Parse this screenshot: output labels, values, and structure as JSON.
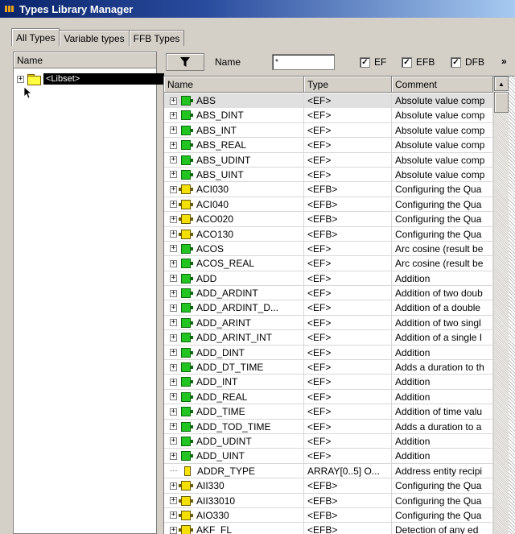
{
  "window": {
    "title": "Types Library Manager"
  },
  "tabs": [
    {
      "label": "All Types",
      "active": true
    },
    {
      "label": "Variable types",
      "active": false
    },
    {
      "label": "FFB Types",
      "active": false
    }
  ],
  "left_pane": {
    "header": "Name",
    "tree": [
      {
        "label": "<Libset>",
        "expander": "+",
        "icon": "folder-icon"
      }
    ]
  },
  "toolbar": {
    "filter_icon": "funnel-icon",
    "name_label": "Name",
    "name_value": "*",
    "checkboxes": [
      {
        "label": "EF",
        "checked": true
      },
      {
        "label": "EFB",
        "checked": true
      },
      {
        "label": "DFB",
        "checked": true
      }
    ],
    "more": "»"
  },
  "grid": {
    "columns": [
      "Name",
      "Type",
      "Comment"
    ],
    "rows": [
      {
        "name": "ABS",
        "type": "<EF>",
        "comment": "Absolute value comp",
        "icon": "ef"
      },
      {
        "name": "ABS_DINT",
        "type": "<EF>",
        "comment": "Absolute value comp",
        "icon": "ef"
      },
      {
        "name": "ABS_INT",
        "type": "<EF>",
        "comment": "Absolute value comp",
        "icon": "ef"
      },
      {
        "name": "ABS_REAL",
        "type": "<EF>",
        "comment": "Absolute value comp",
        "icon": "ef"
      },
      {
        "name": "ABS_UDINT",
        "type": "<EF>",
        "comment": "Absolute value comp",
        "icon": "ef"
      },
      {
        "name": "ABS_UINT",
        "type": "<EF>",
        "comment": "Absolute value comp",
        "icon": "ef"
      },
      {
        "name": "ACI030",
        "type": "<EFB>",
        "comment": "Configuring the Qua",
        "icon": "efb"
      },
      {
        "name": "ACI040",
        "type": "<EFB>",
        "comment": "Configuring the Qua",
        "icon": "efb"
      },
      {
        "name": "ACO020",
        "type": "<EFB>",
        "comment": "Configuring the Qua",
        "icon": "efb"
      },
      {
        "name": "ACO130",
        "type": "<EFB>",
        "comment": "Configuring the Qua",
        "icon": "efb"
      },
      {
        "name": "ACOS",
        "type": "<EF>",
        "comment": "Arc cosine (result be",
        "icon": "ef"
      },
      {
        "name": "ACOS_REAL",
        "type": "<EF>",
        "comment": "Arc cosine (result be",
        "icon": "ef"
      },
      {
        "name": "ADD",
        "type": "<EF>",
        "comment": "Addition",
        "icon": "ef"
      },
      {
        "name": "ADD_ARDINT",
        "type": "<EF>",
        "comment": "Addition of two doub",
        "icon": "ef"
      },
      {
        "name": "ADD_ARDINT_D...",
        "type": "<EF>",
        "comment": "Addition of a double",
        "icon": "ef"
      },
      {
        "name": "ADD_ARINT",
        "type": "<EF>",
        "comment": "Addition of two singl",
        "icon": "ef"
      },
      {
        "name": "ADD_ARINT_INT",
        "type": "<EF>",
        "comment": "Addition of a single I",
        "icon": "ef"
      },
      {
        "name": "ADD_DINT",
        "type": "<EF>",
        "comment": "Addition",
        "icon": "ef"
      },
      {
        "name": "ADD_DT_TIME",
        "type": "<EF>",
        "comment": "Adds a duration to th",
        "icon": "ef"
      },
      {
        "name": "ADD_INT",
        "type": "<EF>",
        "comment": "Addition",
        "icon": "ef"
      },
      {
        "name": "ADD_REAL",
        "type": "<EF>",
        "comment": "Addition",
        "icon": "ef"
      },
      {
        "name": "ADD_TIME",
        "type": "<EF>",
        "comment": "Addition of time valu",
        "icon": "ef"
      },
      {
        "name": "ADD_TOD_TIME",
        "type": "<EF>",
        "comment": "Adds a duration to a",
        "icon": "ef"
      },
      {
        "name": "ADD_UDINT",
        "type": "<EF>",
        "comment": "Addition",
        "icon": "ef"
      },
      {
        "name": "ADD_UINT",
        "type": "<EF>",
        "comment": "Addition",
        "icon": "ef"
      },
      {
        "name": "ADDR_TYPE",
        "type": "ARRAY[0..5] O...",
        "comment": "Address entity recipi",
        "icon": "ddt"
      },
      {
        "name": "AII330",
        "type": "<EFB>",
        "comment": "Configuring the Qua",
        "icon": "efb"
      },
      {
        "name": "AII33010",
        "type": "<EFB>",
        "comment": "Configuring the Qua",
        "icon": "efb"
      },
      {
        "name": "AIO330",
        "type": "<EFB>",
        "comment": "Configuring the Qua",
        "icon": "efb"
      },
      {
        "name": "AKF_FL",
        "type": "<EFB>",
        "comment": "Detection of any ed",
        "icon": "efb"
      }
    ]
  },
  "colors": {
    "title_bar_start": "#0a246a",
    "title_bar_end": "#a6caf0",
    "ef_icon": "#22c422",
    "efb_icon": "#f4e000"
  }
}
